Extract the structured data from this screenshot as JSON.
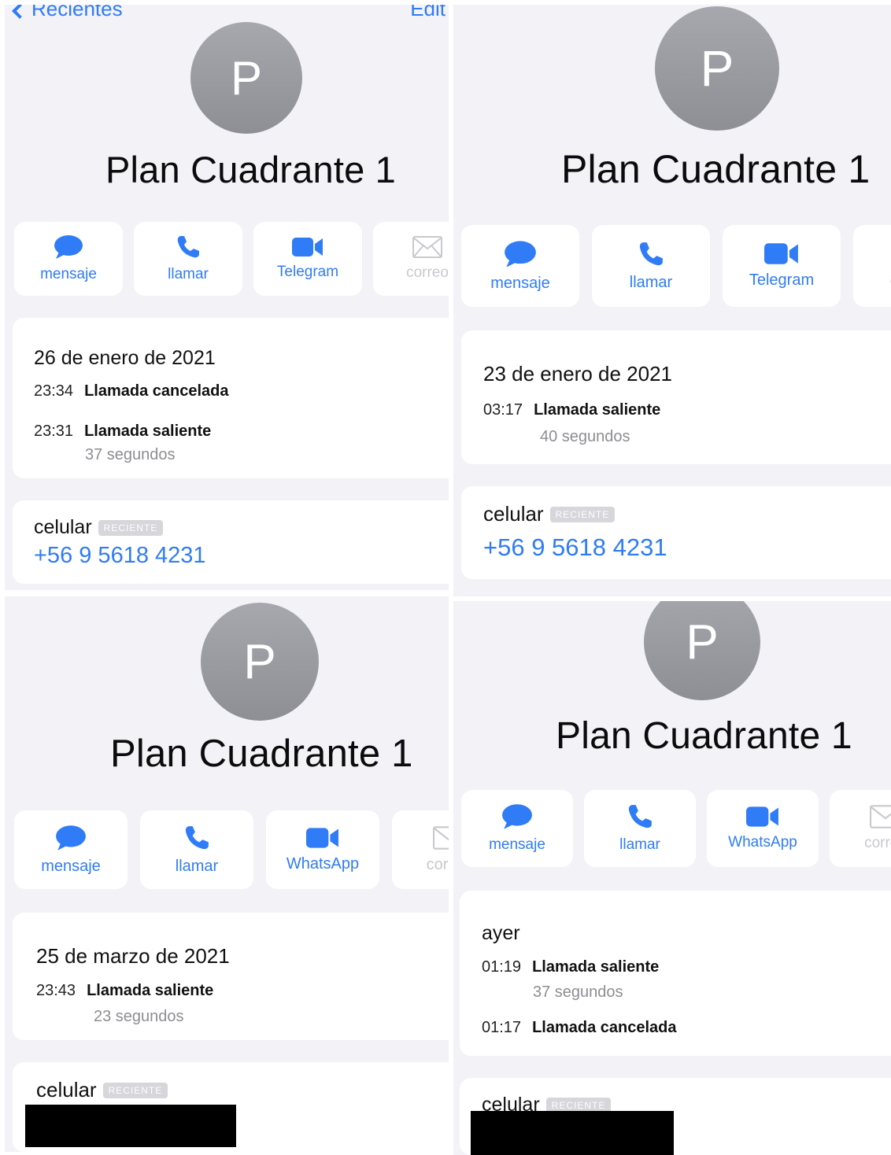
{
  "nav": {
    "back_label": "Recientes",
    "edit_label": "Edit"
  },
  "panels": [
    {
      "avatar_initial": "P",
      "name": "Plan Cuadrante 1",
      "actions": [
        "mensaje",
        "llamar",
        "Telegram",
        "correo"
      ],
      "date": "26 de enero de 2021",
      "calls": [
        {
          "time": "23:34",
          "type": "Llamada cancelada",
          "duration": ""
        },
        {
          "time": "23:31",
          "type": "Llamada saliente",
          "duration": "37 segundos"
        }
      ],
      "phone_label": "celular",
      "badge": "RECIENTE",
      "phone": "+56 9 5618 4231"
    },
    {
      "avatar_initial": "P",
      "name": "Plan Cuadrante 1",
      "actions": [
        "mensaje",
        "llamar",
        "Telegram",
        "correo"
      ],
      "date": "23 de enero de 2021",
      "calls": [
        {
          "time": "03:17",
          "type": "Llamada saliente",
          "duration": "40 segundos"
        }
      ],
      "phone_label": "celular",
      "badge": "RECIENTE",
      "phone": "+56 9 5618 4231"
    },
    {
      "avatar_initial": "P",
      "name": "Plan Cuadrante 1",
      "actions": [
        "mensaje",
        "llamar",
        "WhatsApp",
        "correo"
      ],
      "date": "25 de marzo de 2021",
      "calls": [
        {
          "time": "23:43",
          "type": "Llamada saliente",
          "duration": "23 segundos"
        }
      ],
      "phone_label": "celular",
      "badge": "RECIENTE",
      "phone": ""
    },
    {
      "avatar_initial": "P",
      "name": "Plan Cuadrante 1",
      "actions": [
        "mensaje",
        "llamar",
        "WhatsApp",
        "correo"
      ],
      "date": "ayer",
      "calls": [
        {
          "time": "01:19",
          "type": "Llamada saliente",
          "duration": "37 segundos"
        },
        {
          "time": "01:17",
          "type": "Llamada cancelada",
          "duration": ""
        }
      ],
      "phone_label": "celular",
      "badge": "RECIENTE",
      "phone": ""
    }
  ],
  "colors": {
    "accent": "#2f7cf6",
    "background": "#f2f2f7",
    "card": "#ffffff",
    "muted": "#8e8e93",
    "avatar": "#9a9ca2"
  }
}
